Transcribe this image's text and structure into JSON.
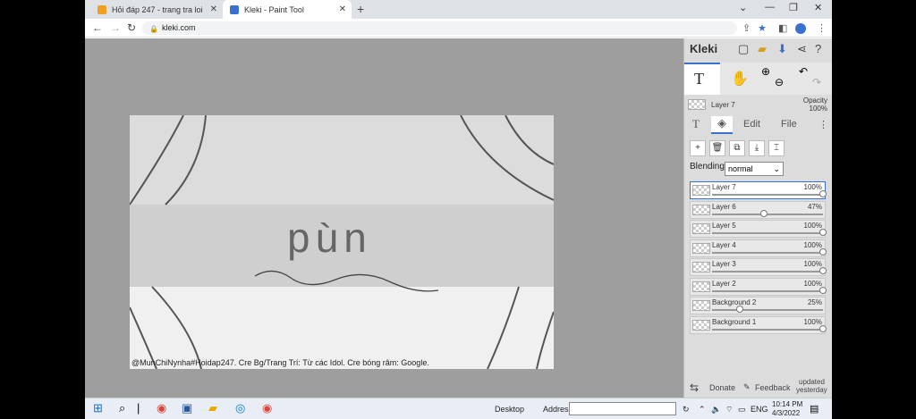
{
  "tabs": [
    {
      "title": "Hỏi đáp 247 - trang tra loi",
      "favicon_color": "#f0a020"
    },
    {
      "title": "Kleki - Paint Tool",
      "favicon_color": "#3a70d0"
    }
  ],
  "address": {
    "url": "kleki.com"
  },
  "canvas": {
    "word": "pùn",
    "credit": "@MunChiNynha#Hoidap247. Cre Bg/Trang Trí: Từ các Idol. Cre bóng râm: Google."
  },
  "panel": {
    "logo": "Kleki",
    "current_layer": "Layer 7",
    "opacity_label": "Opacity",
    "opacity_value": "100%",
    "tabs": {
      "edit": "Edit",
      "file": "File"
    },
    "blending_label": "Blending",
    "blending_value": "normal",
    "layers": [
      {
        "name": "Layer 7",
        "opacity": "100%",
        "level": 1.0,
        "selected": true
      },
      {
        "name": "Layer 6",
        "opacity": "47%",
        "level": 0.47,
        "selected": false
      },
      {
        "name": "Layer 5",
        "opacity": "100%",
        "level": 1.0,
        "selected": false
      },
      {
        "name": "Layer 4",
        "opacity": "100%",
        "level": 1.0,
        "selected": false
      },
      {
        "name": "Layer 3",
        "opacity": "100%",
        "level": 1.0,
        "selected": false
      },
      {
        "name": "Layer 2",
        "opacity": "100%",
        "level": 1.0,
        "selected": false
      },
      {
        "name": "Background 2",
        "opacity": "25%",
        "level": 0.25,
        "selected": false
      },
      {
        "name": "Background 1",
        "opacity": "100%",
        "level": 1.0,
        "selected": false
      }
    ],
    "bottom": {
      "donate": "Donate",
      "feedback": "Feedback",
      "updated": "updated",
      "updated2": "yesterday"
    }
  },
  "taskbar": {
    "desktop": "Desktop",
    "address": "Address",
    "lang": "ENG",
    "time": "10:14 PM",
    "date": "4/3/2022"
  }
}
